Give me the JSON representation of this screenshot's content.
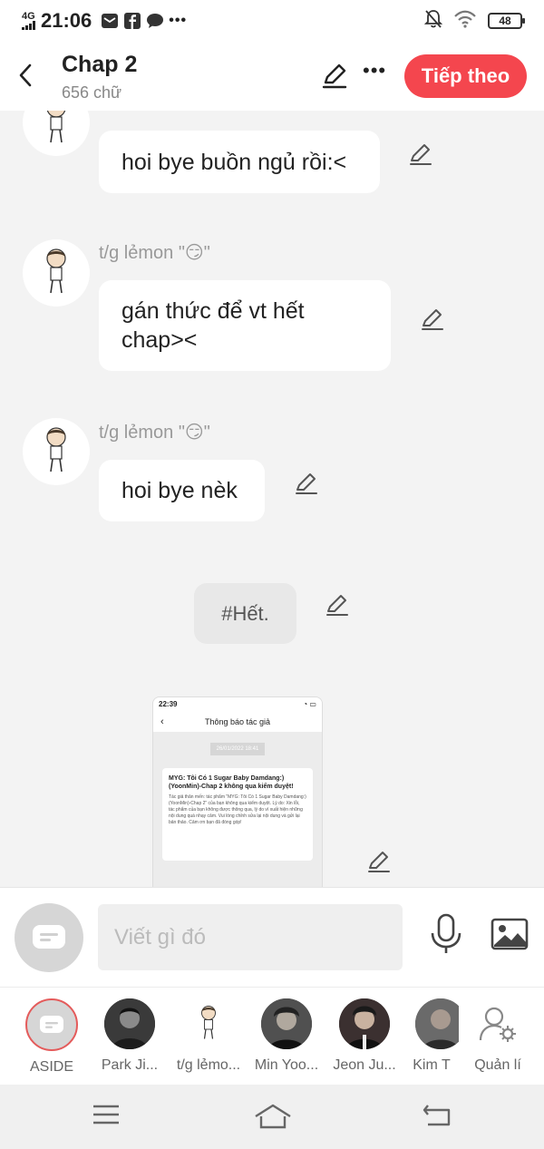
{
  "status": {
    "network": "4G",
    "time": "21:06",
    "battery": "48"
  },
  "header": {
    "title": "Chap 2",
    "word_count": "656 chữ",
    "next_label": "Tiếp theo"
  },
  "messages": [
    {
      "sender": "",
      "text": "hoi bye buồn ngủ rồi:<"
    },
    {
      "sender": "t/g lẻmon \"😏\"",
      "text": "gán thức để vt hết chap><"
    },
    {
      "sender": "t/g lẻmon \"😏\"",
      "text": "hoi bye nèk"
    }
  ],
  "end_marker": "#Hết.",
  "embedded_shot": {
    "status_time": "22:39",
    "title": "Thông báo tác giả",
    "date": "26/01/2022 18:41",
    "heading": "MYG: Tôi Có 1 Sugar Baby Damdang:) (YoonMin)-Chap 2 không qua kiểm duyệt!",
    "body": "Tác giả thân mến: tác phẩm \"MYG: Tôi Có 1 Sugar Baby Damdang:) (YoonMin)-Chap 2\" của bạn không qua kiểm duyệt. Lý do: Xin lỗi, tác phẩm của bạn không được thông qua, lý do vì xuất hiện những nội dung quá nhạy cảm. Vui lòng chỉnh sửa lại nội dung và gửi lại bản thảo. Cảm ơn bạn đã đóng góp!"
  },
  "input": {
    "placeholder": "Viết gì đó"
  },
  "characters": [
    {
      "name": "ASIDE"
    },
    {
      "name": "Park Ji..."
    },
    {
      "name": "t/g lẻmo..."
    },
    {
      "name": "Min Yoo..."
    },
    {
      "name": "Jeon Ju..."
    },
    {
      "name": "Kim T"
    },
    {
      "name": "Quản lí"
    }
  ],
  "colors": {
    "accent": "#f4464e",
    "background": "#f3f3f3"
  }
}
